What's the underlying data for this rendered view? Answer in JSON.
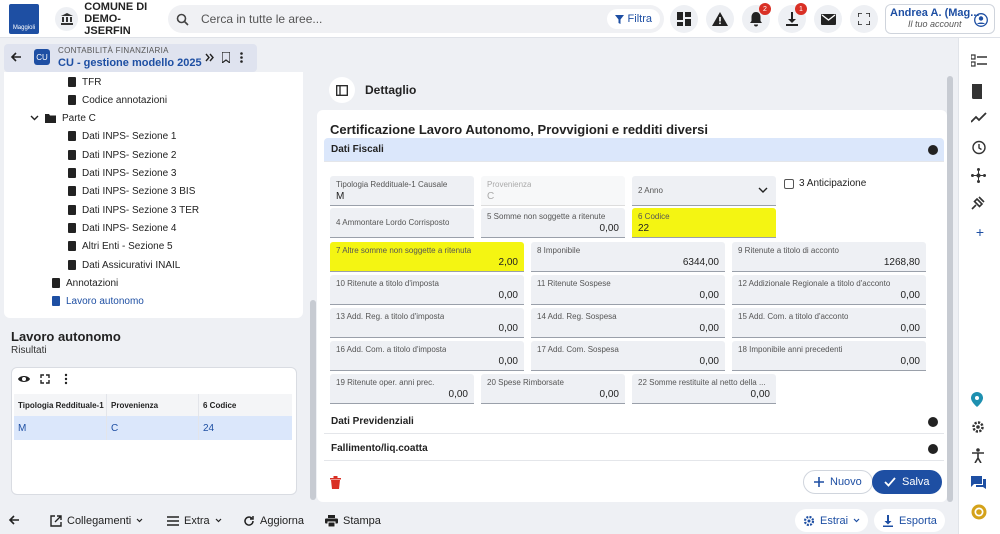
{
  "header": {
    "logo_text": "Maggioli",
    "entity_line1": "COMUNE DI",
    "entity_line2": "DEMO-JSERFIN",
    "search_placeholder": "Cerca in tutte le aree...",
    "filter_label": "Filtra",
    "notifications_count": "2",
    "downloads_count": "1",
    "user_name": "Andrea A. (Mag...",
    "user_subtitle": "Il tuo account"
  },
  "context": {
    "app_label": "CONTABILITÀ FINANZIARIA",
    "module_title": "CU - gestione modello 2025"
  },
  "tree": {
    "items": [
      {
        "label": "TFR",
        "level": 2,
        "type": "doc"
      },
      {
        "label": "Codice annotazioni",
        "level": 2,
        "type": "doc"
      },
      {
        "label": "Parte C",
        "level": 1,
        "type": "folder"
      },
      {
        "label": "Dati INPS- Sezione 1",
        "level": 2,
        "type": "doc"
      },
      {
        "label": "Dati INPS- Sezione 2",
        "level": 2,
        "type": "doc"
      },
      {
        "label": "Dati INPS- Sezione 3",
        "level": 2,
        "type": "doc"
      },
      {
        "label": "Dati INPS- Sezione 3 BIS",
        "level": 2,
        "type": "doc"
      },
      {
        "label": "Dati INPS- Sezione 3 TER",
        "level": 2,
        "type": "doc"
      },
      {
        "label": "Dati INPS- Sezione 4",
        "level": 2,
        "type": "doc"
      },
      {
        "label": "Altri Enti - Sezione 5",
        "level": 2,
        "type": "doc"
      },
      {
        "label": "Dati Assicurativi INAIL",
        "level": 2,
        "type": "doc"
      },
      {
        "label": "Annotazioni",
        "level": 1,
        "type": "doc"
      },
      {
        "label": "Lavoro autonomo",
        "level": 1,
        "type": "doc",
        "active": true
      }
    ]
  },
  "results": {
    "title": "Lavoro autonomo",
    "subtitle": "Risultati",
    "columns": [
      "Tipologia Reddituale-1",
      "Provenienza",
      "6 Codice"
    ],
    "rows": [
      [
        "M",
        "C",
        "24"
      ]
    ]
  },
  "detail": {
    "bar_title": "Dettaglio",
    "form_title": "Certificazione Lavoro Autonomo, Provvigioni e redditi diversi",
    "sections": [
      "Dati Fiscali",
      "Dati Previdenziali",
      "Fallimento/liq.coatta"
    ],
    "fields": {
      "tipologia": {
        "label": "Tipologia Reddituale-1 Causale",
        "value": "M"
      },
      "provenienza": {
        "label": "Provenienza",
        "value": "C"
      },
      "anno": {
        "label": "2 Anno",
        "value": ""
      },
      "anticipazione": {
        "label": "3 Anticipazione"
      },
      "f4": {
        "label": "4 Ammontare Lordo Corrisposto",
        "value": ""
      },
      "f5": {
        "label": "5 Somme non soggette a ritenute",
        "value": "0,00"
      },
      "f6": {
        "label": "6 Codice",
        "value": "22"
      },
      "f7": {
        "label": "7 Altre somme non soggette a ritenuta",
        "value": "2,00"
      },
      "f8": {
        "label": "8 Imponibile",
        "value": "6344,00"
      },
      "f9": {
        "label": "9 Ritenute a titolo di acconto",
        "value": "1268,80"
      },
      "f10": {
        "label": "10 Ritenute a titolo d'imposta",
        "value": "0,00"
      },
      "f11": {
        "label": "11 Ritenute Sospese",
        "value": "0,00"
      },
      "f12": {
        "label": "12 Addizionale Regionale a titolo d'acconto",
        "value": "0,00"
      },
      "f13": {
        "label": "13 Add. Reg. a titolo d'imposta",
        "value": "0,00"
      },
      "f14": {
        "label": "14 Add. Reg. Sospesa",
        "value": "0,00"
      },
      "f15": {
        "label": "15 Add. Com. a titolo d'acconto",
        "value": "0,00"
      },
      "f16": {
        "label": "16 Add. Com. a titolo d'imposta",
        "value": "0,00"
      },
      "f17": {
        "label": "17 Add. Com. Sospesa",
        "value": "0,00"
      },
      "f18": {
        "label": "18 Imponibile anni precedenti",
        "value": "0,00"
      },
      "f19": {
        "label": "19 Ritenute oper. anni prec.",
        "value": "0,00"
      },
      "f20": {
        "label": "20 Spese Rimborsate",
        "value": "0,00"
      },
      "f22": {
        "label": "22 Somme restituite al netto della ...",
        "value": "0,00"
      }
    },
    "nuovo_label": "Nuovo",
    "salva_label": "Salva"
  },
  "footer": {
    "collegamenti": "Collegamenti",
    "extra": "Extra",
    "aggiorna": "Aggiorna",
    "stampa": "Stampa",
    "estrai": "Estrai",
    "esporta": "Esporta"
  },
  "colors": {
    "primary": "#1e4fa3",
    "highlight": "#f4f512",
    "danger": "#d93025"
  }
}
